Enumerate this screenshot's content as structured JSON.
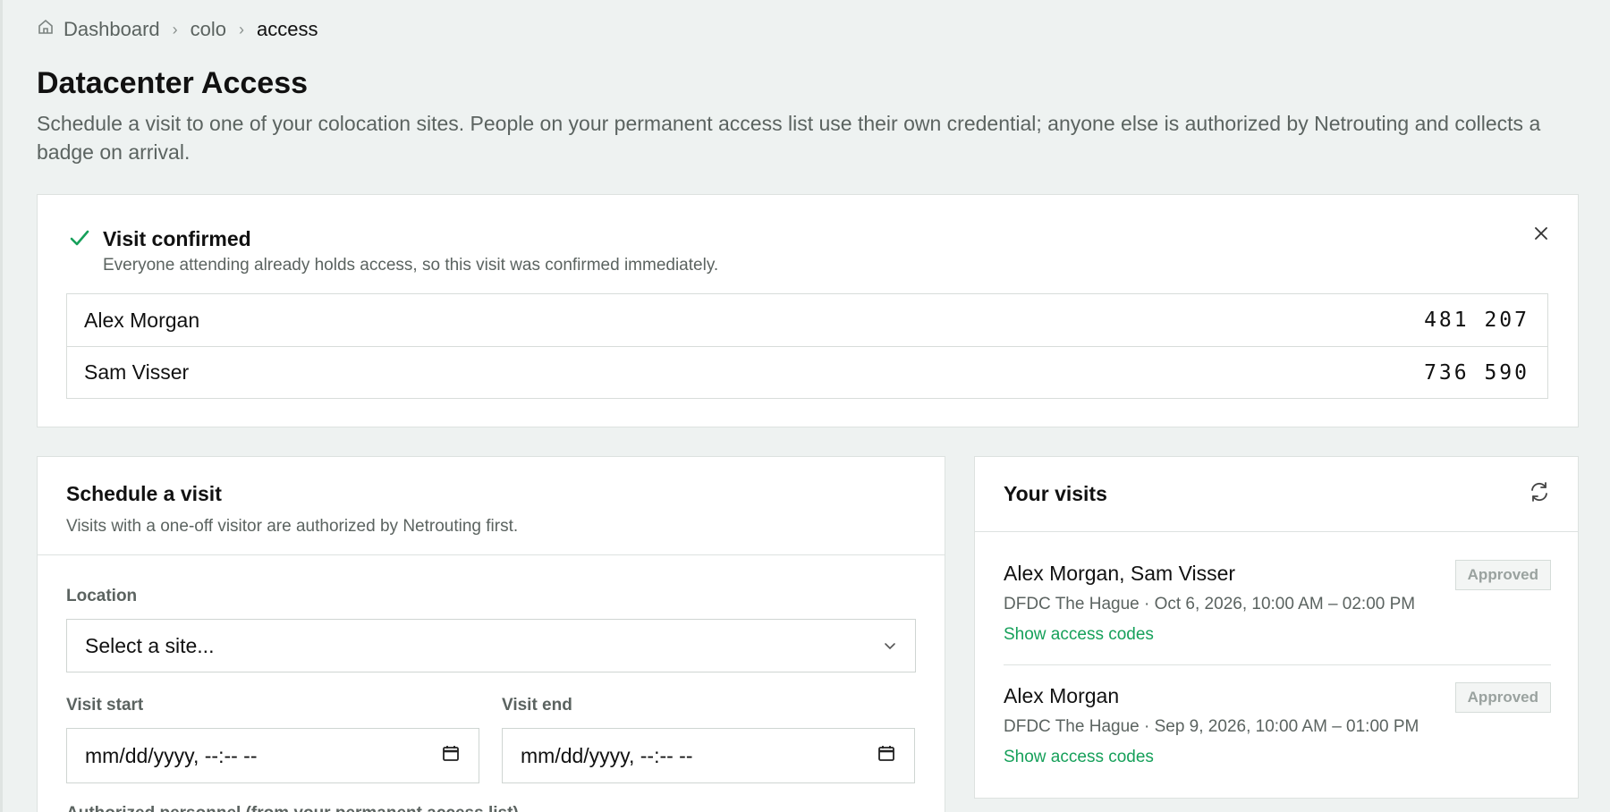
{
  "breadcrumb": {
    "home": "Dashboard",
    "middle": "colo",
    "current": "access"
  },
  "header": {
    "title": "Datacenter Access",
    "subtitle": "Schedule a visit to one of your colocation sites. People on your permanent access list use their own credential; anyone else is authorized by Netrouting and collects a badge on arrival."
  },
  "confirmation": {
    "title": "Visit confirmed",
    "description": "Everyone attending already holds access, so this visit was confirmed immediately.",
    "codes": [
      {
        "name": "Alex Morgan",
        "code": "481 207"
      },
      {
        "name": "Sam Visser",
        "code": "736 590"
      }
    ]
  },
  "schedule": {
    "title": "Schedule a visit",
    "description": "Visits with a one-off visitor are authorized by Netrouting first.",
    "location_label": "Location",
    "location_value": "Select a site...",
    "start_label": "Visit start",
    "start_value": "mm/dd/yyyy, --:-- --",
    "end_label": "Visit end",
    "end_value": "mm/dd/yyyy, --:-- --",
    "next_label": "Authorized personnel (from your permanent access list)"
  },
  "visits": {
    "title": "Your visits",
    "items": [
      {
        "names": "Alex Morgan, Sam Visser",
        "meta": "DFDC The Hague · Oct 6, 2026, 10:00 AM – 02:00 PM",
        "status": "Approved",
        "link": "Show access codes"
      },
      {
        "names": "Alex Morgan",
        "meta": "DFDC The Hague · Sep 9, 2026, 10:00 AM – 01:00 PM",
        "status": "Approved",
        "link": "Show access codes"
      }
    ]
  },
  "colors": {
    "accent": "#16a05a",
    "background": "#eef2f1",
    "muted": "#5b6360"
  },
  "icons": [
    "home-icon",
    "chevron-right-icon",
    "check-icon",
    "close-icon",
    "chevron-down-icon",
    "calendar-icon",
    "refresh-icon"
  ]
}
